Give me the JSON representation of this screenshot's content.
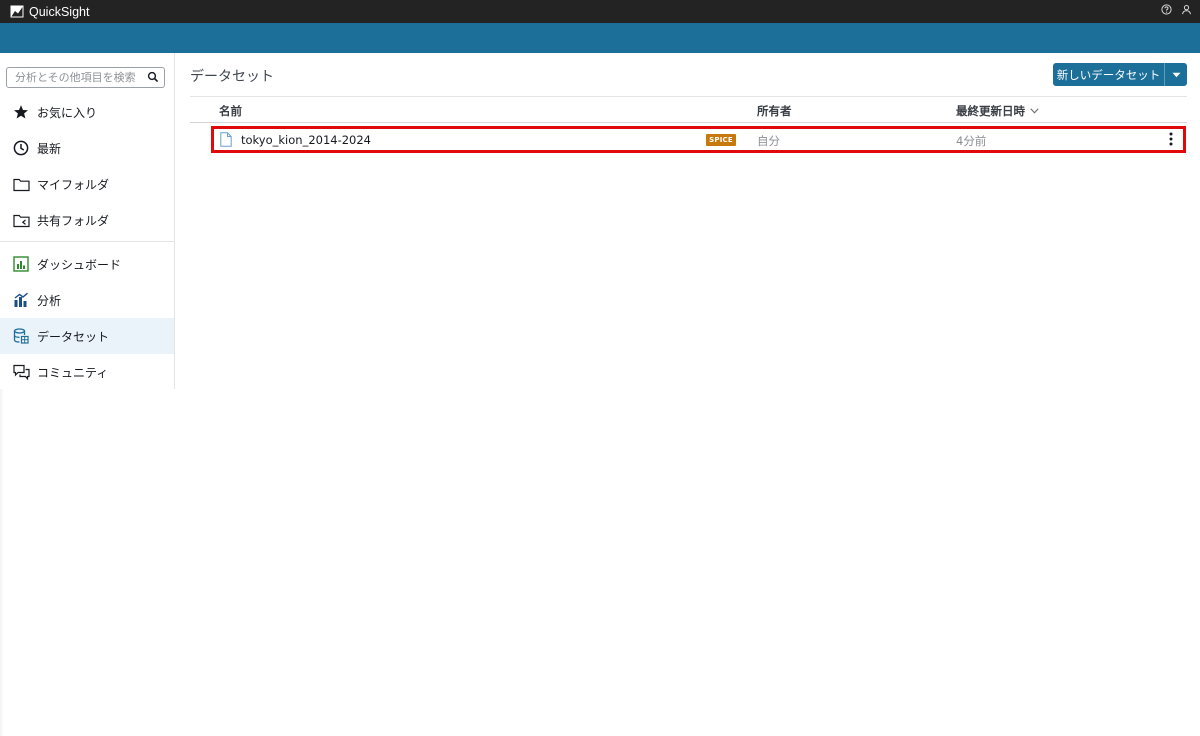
{
  "app": {
    "title": "QuickSight"
  },
  "sidebar": {
    "search": {
      "placeholder": "分析とその他項目を検索"
    },
    "items": [
      {
        "label": "お気に入り",
        "icon": "star-icon"
      },
      {
        "label": "最新",
        "icon": "clock-icon"
      },
      {
        "label": "マイフォルダ",
        "icon": "folder-icon"
      },
      {
        "label": "共有フォルダ",
        "icon": "shared-folder-icon"
      },
      {
        "label": "ダッシュボード",
        "icon": "dashboard-icon"
      },
      {
        "label": "分析",
        "icon": "analysis-icon"
      },
      {
        "label": "データセット",
        "icon": "dataset-icon",
        "active": true
      },
      {
        "label": "コミュニティ",
        "icon": "community-icon"
      }
    ]
  },
  "main": {
    "title": "データセット",
    "new_button_label": "新しいデータセット",
    "table": {
      "columns": {
        "name": "名前",
        "owner": "所有者",
        "updated": "最終更新日時"
      },
      "rows": [
        {
          "name": "tokyo_kion_2014-2024",
          "badge": "SPICE",
          "owner": "自分",
          "updated": "4分前"
        }
      ]
    }
  },
  "colors": {
    "topbar": "#232323",
    "header_band": "#1c6f98",
    "primary_button": "#1c6f98",
    "spice_badge": "#c8790d",
    "highlight_border": "#e00a0a",
    "active_nav_bg": "#e9f3f9"
  }
}
